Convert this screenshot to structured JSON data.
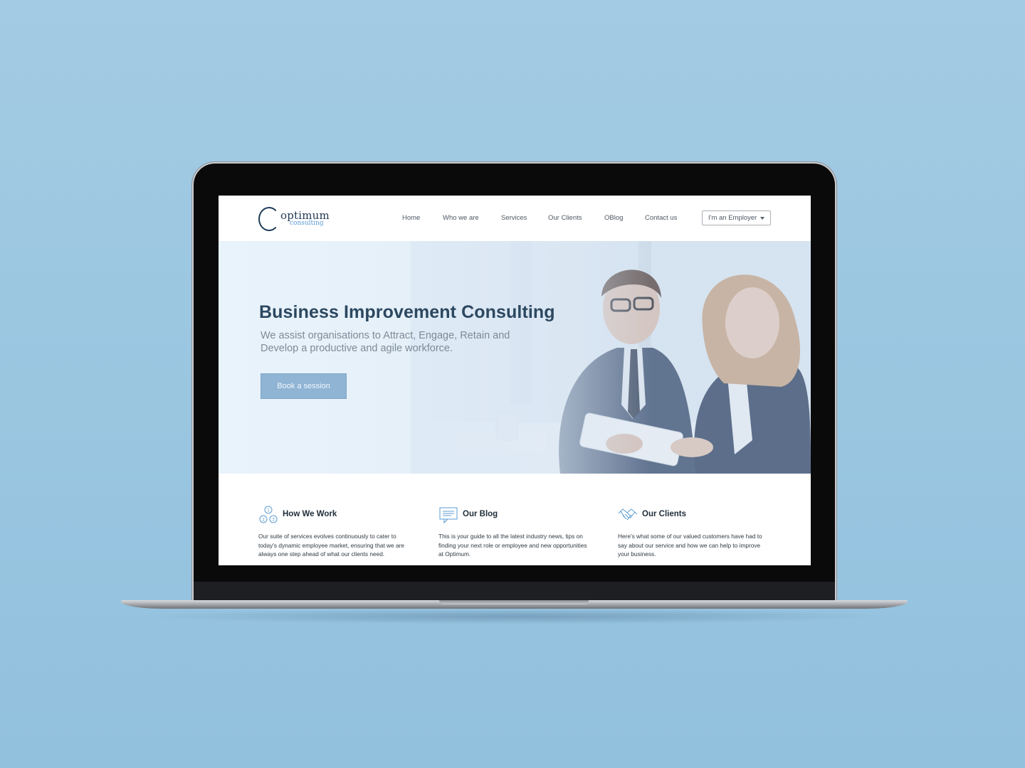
{
  "logo": {
    "main": "optimum",
    "sub": "consulting"
  },
  "nav": {
    "items": [
      {
        "label": "Home"
      },
      {
        "label": "Who we are"
      },
      {
        "label": "Services"
      },
      {
        "label": "Our Clients"
      },
      {
        "label": "OBlog"
      },
      {
        "label": "Contact us"
      }
    ],
    "employer_dropdown": "I'm an Employer"
  },
  "hero": {
    "title": "Business Improvement Consulting",
    "subtitle": "We assist organisations to Attract, Engage, Retain and Develop a productive and agile workforce.",
    "cta": "Book a session"
  },
  "features": [
    {
      "icon": "numbered-circles-icon",
      "title": "How We Work",
      "text": "Our suite of services evolves continuously to cater to today's dynamic employee market, ensuring that we are always one step ahead of what our clients need."
    },
    {
      "icon": "chat-bubble-icon",
      "title": "Our Blog",
      "text": "This is your guide to all the latest industry news, tips on finding your next role or employee and new opportunities at Optimum."
    },
    {
      "icon": "handshake-icon",
      "title": "Our Clients",
      "text": "Here's what some of our valued customers have had to say about our service and how we can help to improve your business."
    }
  ],
  "colors": {
    "background": "#a3cbe3",
    "accent": "#8fb4d4",
    "heading": "#2c4860",
    "icon": "#5b9bd0"
  }
}
